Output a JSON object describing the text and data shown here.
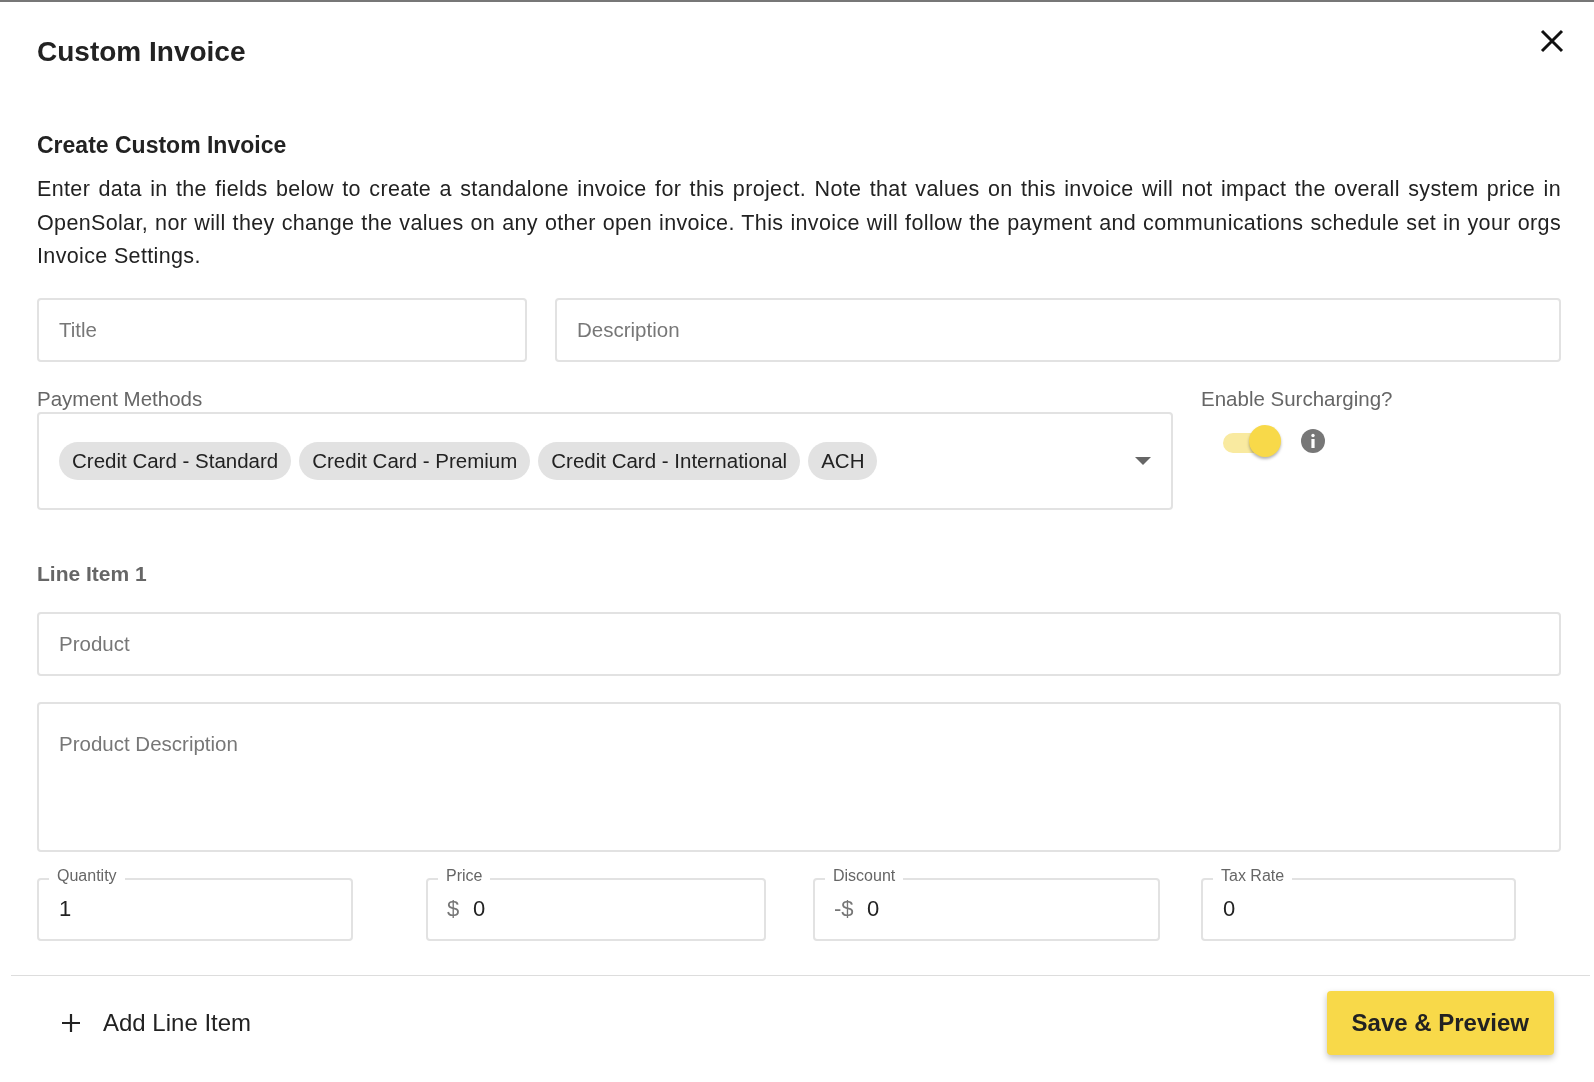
{
  "dialog": {
    "title": "Custom Invoice"
  },
  "section": {
    "heading": "Create Custom Invoice",
    "intro": "Enter data in the fields below to create a standalone invoice for this project. Note that values on this invoice will not impact the overall system price in OpenSolar, nor will they change the values on any other open invoice. This invoice will follow the payment and communications schedule set in your orgs Invoice Settings."
  },
  "fields": {
    "title": {
      "placeholder": "Title"
    },
    "description": {
      "placeholder": "Description"
    }
  },
  "payment_methods": {
    "label": "Payment Methods",
    "chips": [
      "Credit Card - Standard",
      "Credit Card - Premium",
      "Credit Card - International",
      "ACH"
    ]
  },
  "surcharging": {
    "label": "Enable Surcharging?",
    "on": true
  },
  "line_items": [
    {
      "heading": "Line Item 1",
      "product": {
        "placeholder": "Product"
      },
      "product_description": {
        "placeholder": "Product Description"
      },
      "amounts": [
        {
          "label": "Quantity",
          "value": "1"
        },
        {
          "label": "Price",
          "prefix": "$",
          "value": "0"
        },
        {
          "label": "Discount",
          "prefix": "-$",
          "value": "0"
        },
        {
          "label": "Tax Rate",
          "value": "0"
        }
      ]
    }
  ],
  "footer": {
    "add_button": "Add Line Item",
    "save_button": "Save & Preview"
  }
}
